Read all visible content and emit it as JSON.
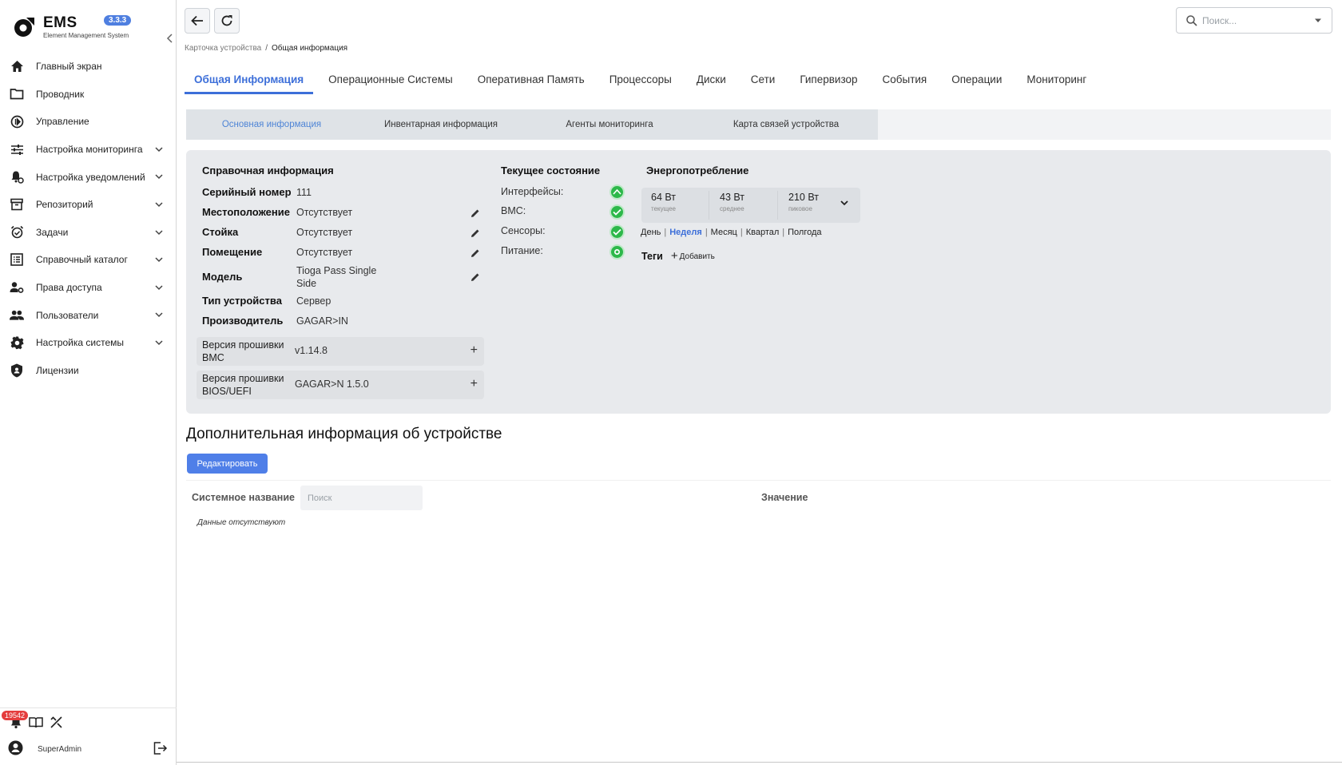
{
  "app": {
    "name": "EMS",
    "subtitle": "Element Management System",
    "version": "3.3.3"
  },
  "sidebar": {
    "items": [
      {
        "label": "Главный экран",
        "icon": "home-icon",
        "expandable": false
      },
      {
        "label": "Проводник",
        "icon": "folder-icon",
        "expandable": false
      },
      {
        "label": "Управление",
        "icon": "play-circle-icon",
        "expandable": false
      },
      {
        "label": "Настройка мониторинга",
        "icon": "sliders-icon",
        "expandable": true
      },
      {
        "label": "Настройка уведомлений",
        "icon": "bell-gear-icon",
        "expandable": true
      },
      {
        "label": "Репозиторий",
        "icon": "archive-icon",
        "expandable": true
      },
      {
        "label": "Задачи",
        "icon": "alarm-check-icon",
        "expandable": true
      },
      {
        "label": "Справочный каталог",
        "icon": "list-icon",
        "expandable": true
      },
      {
        "label": "Права доступа",
        "icon": "user-gear-icon",
        "expandable": true
      },
      {
        "label": "Пользователи",
        "icon": "users-icon",
        "expandable": true
      },
      {
        "label": "Настройка системы",
        "icon": "gear-icon",
        "expandable": true
      },
      {
        "label": "Лицензии",
        "icon": "shield-icon",
        "expandable": false
      }
    ],
    "notifications_count": "19542",
    "user_name": "SuperAdmin"
  },
  "topbar": {
    "search_placeholder": "Поиск..."
  },
  "breadcrumb": {
    "parent": "Карточка устройства",
    "separator": "/",
    "current": "Общая информация"
  },
  "main_tabs": [
    {
      "label": "Общая Информация",
      "active": true
    },
    {
      "label": "Операционные Системы",
      "active": false
    },
    {
      "label": "Оперативная Память",
      "active": false
    },
    {
      "label": "Процессоры",
      "active": false
    },
    {
      "label": "Диски",
      "active": false
    },
    {
      "label": "Сети",
      "active": false
    },
    {
      "label": "Гипервизор",
      "active": false
    },
    {
      "label": "События",
      "active": false
    },
    {
      "label": "Операции",
      "active": false
    },
    {
      "label": "Мониторинг",
      "active": false
    }
  ],
  "sub_tabs": [
    {
      "label": "Основная информация",
      "active": true
    },
    {
      "label": "Инвентарная информация",
      "active": false
    },
    {
      "label": "Агенты мониторинга",
      "active": false
    },
    {
      "label": "Карта связей устройства",
      "active": false
    }
  ],
  "reference": {
    "title": "Справочная информация",
    "serial_label": "Серийный номер",
    "serial_value": "111",
    "location_label": "Местоположение",
    "location_value": "Отсутствует",
    "rack_label": "Стойка",
    "rack_value": "Отсутствует",
    "room_label": "Помещение",
    "room_value": "Отсутствует",
    "model_label": "Модель",
    "model_value_line1": "Tioga Pass Single",
    "model_value_line2": "Side",
    "type_label": "Тип устройства",
    "type_value": "Сервер",
    "vendor_label": "Производитель",
    "vendor_value": "GAGAR>IN",
    "bmc_fw_label_line1": "Версия прошивки",
    "bmc_fw_label_line2": "BMC",
    "bmc_fw_value": "v1.14.8",
    "bios_fw_label_line1": "Версия прошивки",
    "bios_fw_label_line2": "BIOS/UEFI",
    "bios_fw_value": "GAGAR>N 1.5.0"
  },
  "status": {
    "title": "Текущее состояние",
    "interfaces_label": "Интерфейсы:",
    "bmc_label": "BMC:",
    "sensors_label": "Сенсоры:",
    "power_label": "Питание:",
    "color_ok": "#2db84a"
  },
  "energy": {
    "title": "Энергопотребление",
    "current_value": "64 Вт",
    "current_label": "текущее",
    "average_value": "43 Вт",
    "average_label": "среднее",
    "peak_value": "210 Вт",
    "peak_label": "пиковое",
    "periods": [
      "День",
      "Неделя",
      "Месяц",
      "Квартал",
      "Полгода"
    ],
    "active_period": "Неделя",
    "tags_label": "Теги",
    "add_tag_label": "Добавить"
  },
  "additional": {
    "title": "Дополнительная информация об устройстве",
    "edit_button": "Редактировать",
    "col_system_name": "Системное название",
    "col_search_placeholder": "Поиск",
    "col_value": "Значение",
    "no_data": "Данные отсутствуют"
  },
  "colors": {
    "accent": "#3d6fd9",
    "button": "#4f7fe8",
    "panel": "#e8eaed",
    "badge": "#e43d3d"
  }
}
